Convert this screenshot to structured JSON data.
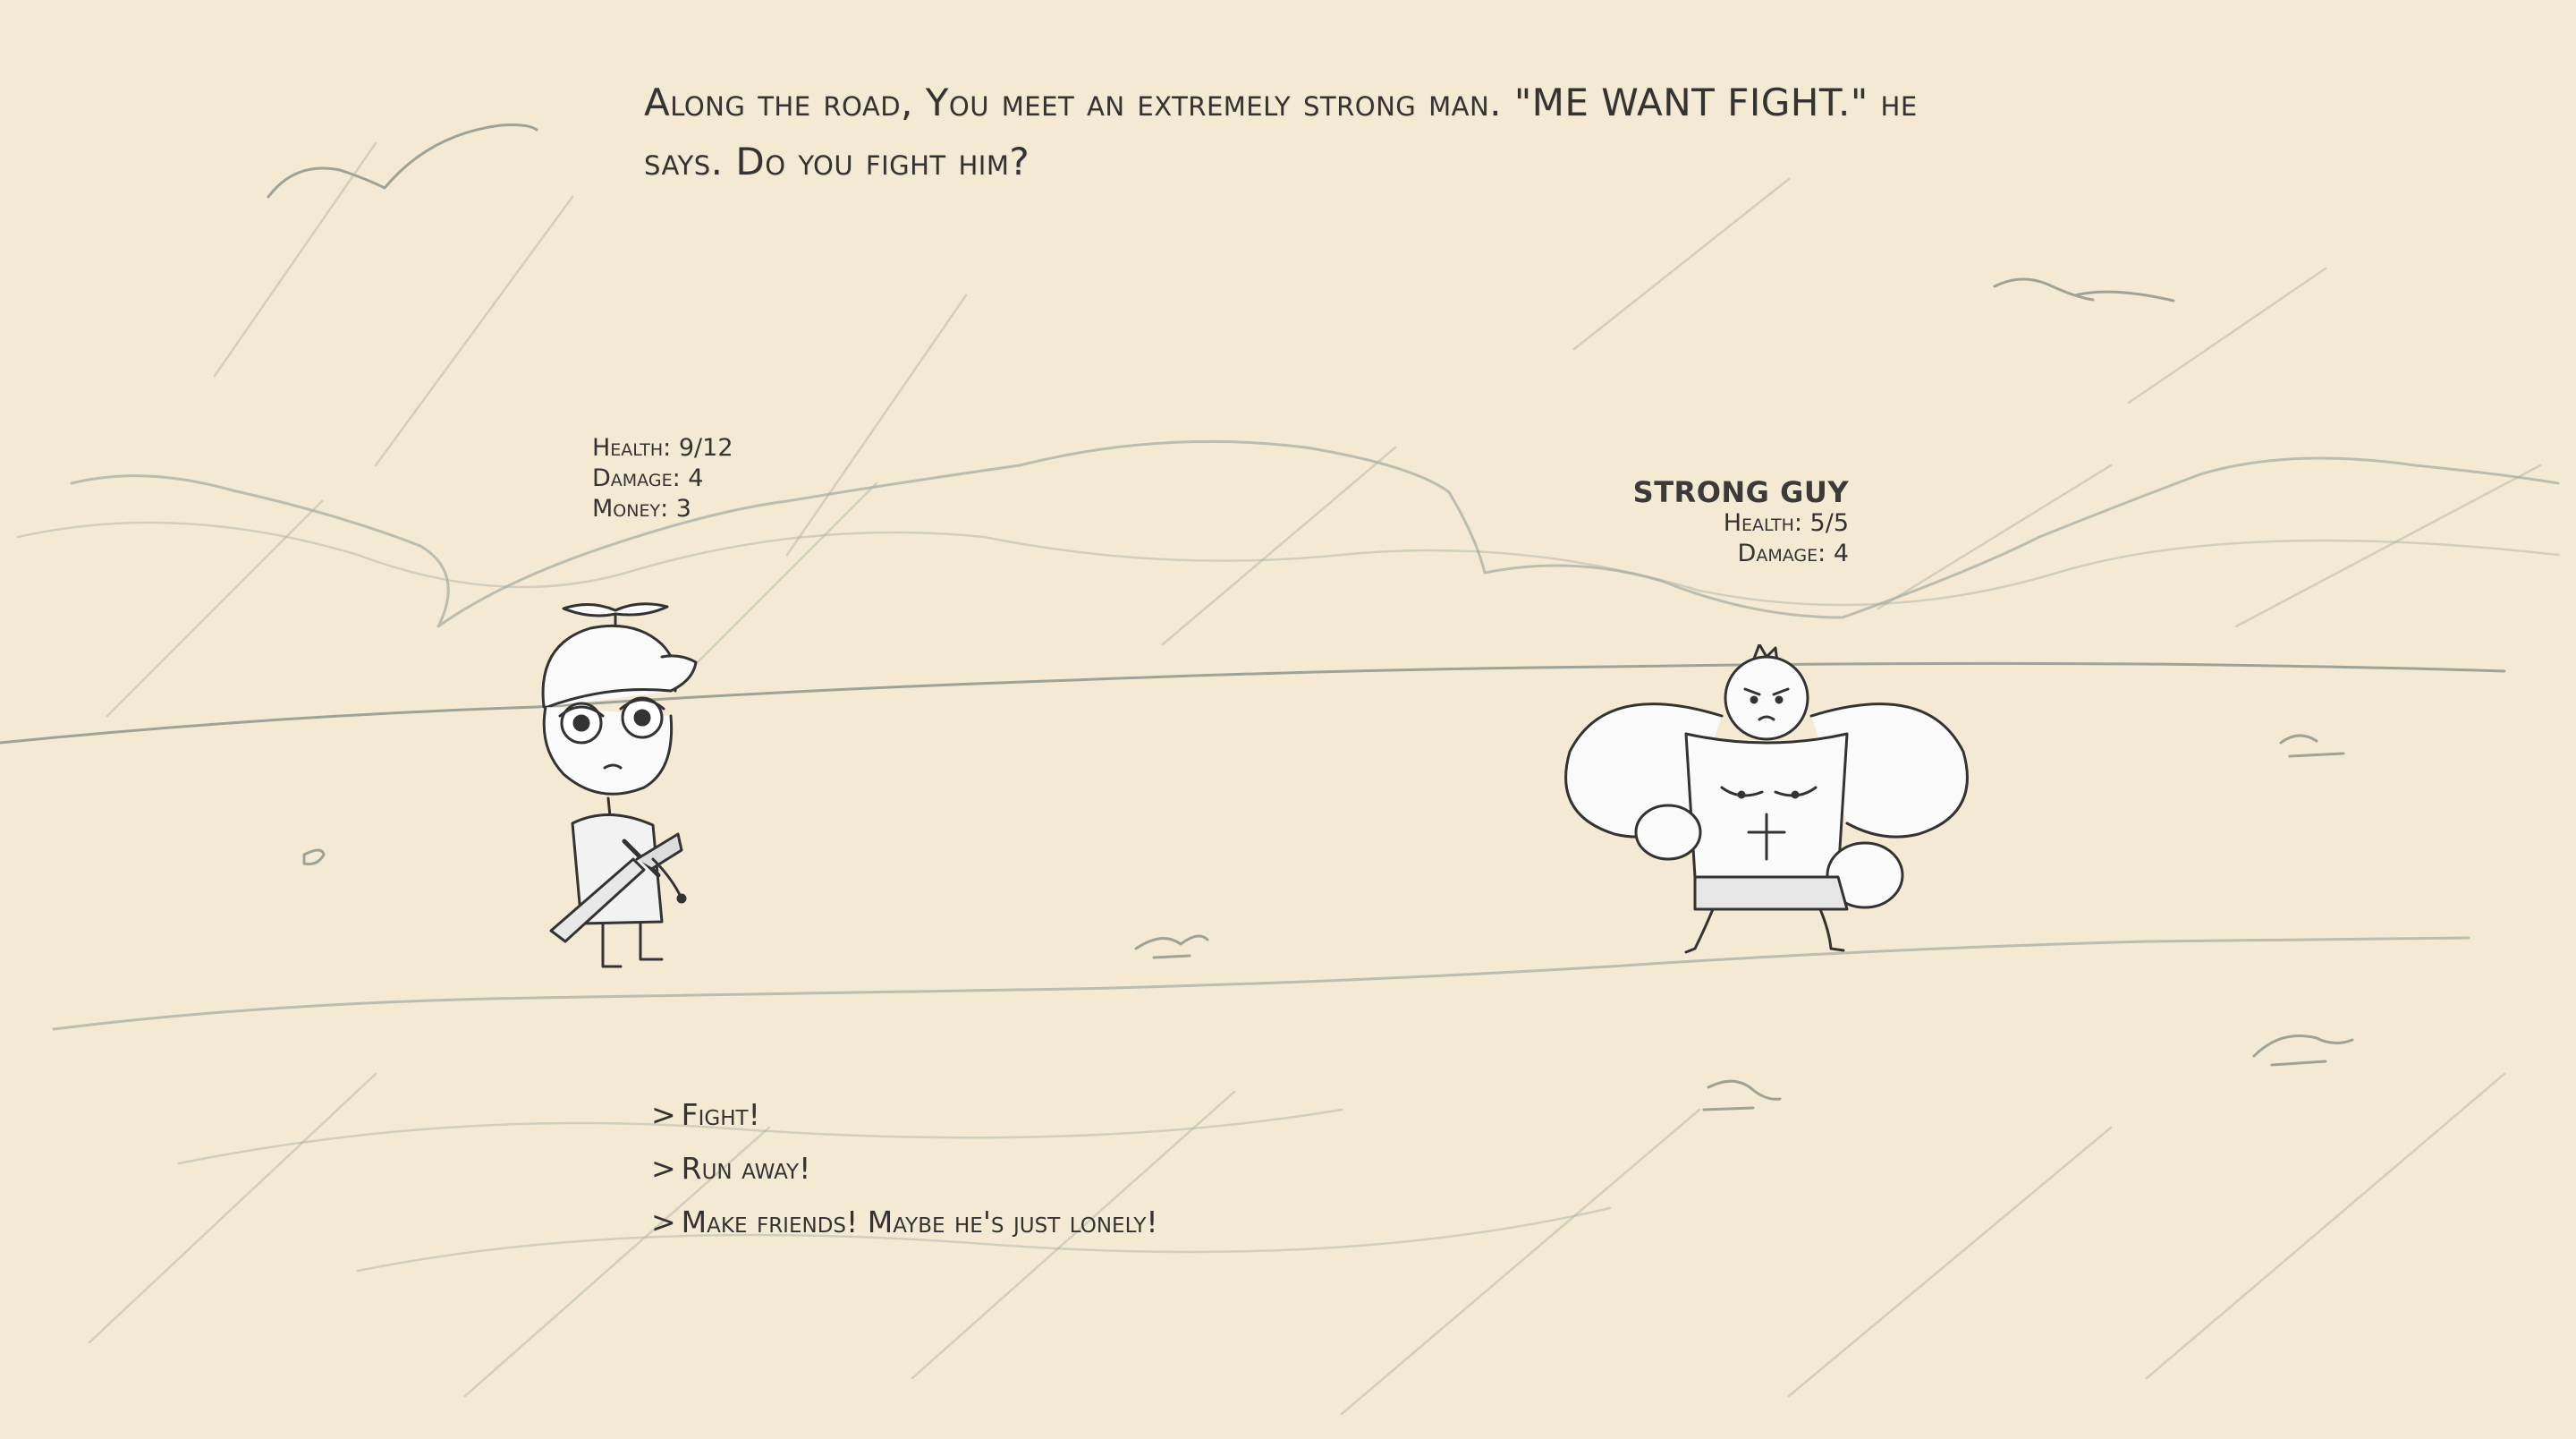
{
  "narration": "Along the road, You meet an extremely strong man. \"ME WANT FIGHT.\" he says. Do you fight him?",
  "player": {
    "sprite": "propeller-cap-kid-with-sword",
    "stats": [
      {
        "label": "Health",
        "value": "9/12"
      },
      {
        "label": "Damage",
        "value": "4"
      },
      {
        "label": "Money",
        "value": "3"
      }
    ]
  },
  "enemy": {
    "name": "STRONG GUY",
    "sprite": "muscular-man",
    "stats": [
      {
        "label": "Health",
        "value": "5/5"
      },
      {
        "label": "Damage",
        "value": "4"
      }
    ]
  },
  "choices": [
    {
      "prefix": ">",
      "label": "Fight!"
    },
    {
      "prefix": ">",
      "label": "Run away!"
    },
    {
      "prefix": ">",
      "label": "Make friends! Maybe he's just lonely!"
    }
  ],
  "colors": {
    "paper": "#f4ead3",
    "pencil": "#a7aea4",
    "ink": "#333333"
  }
}
